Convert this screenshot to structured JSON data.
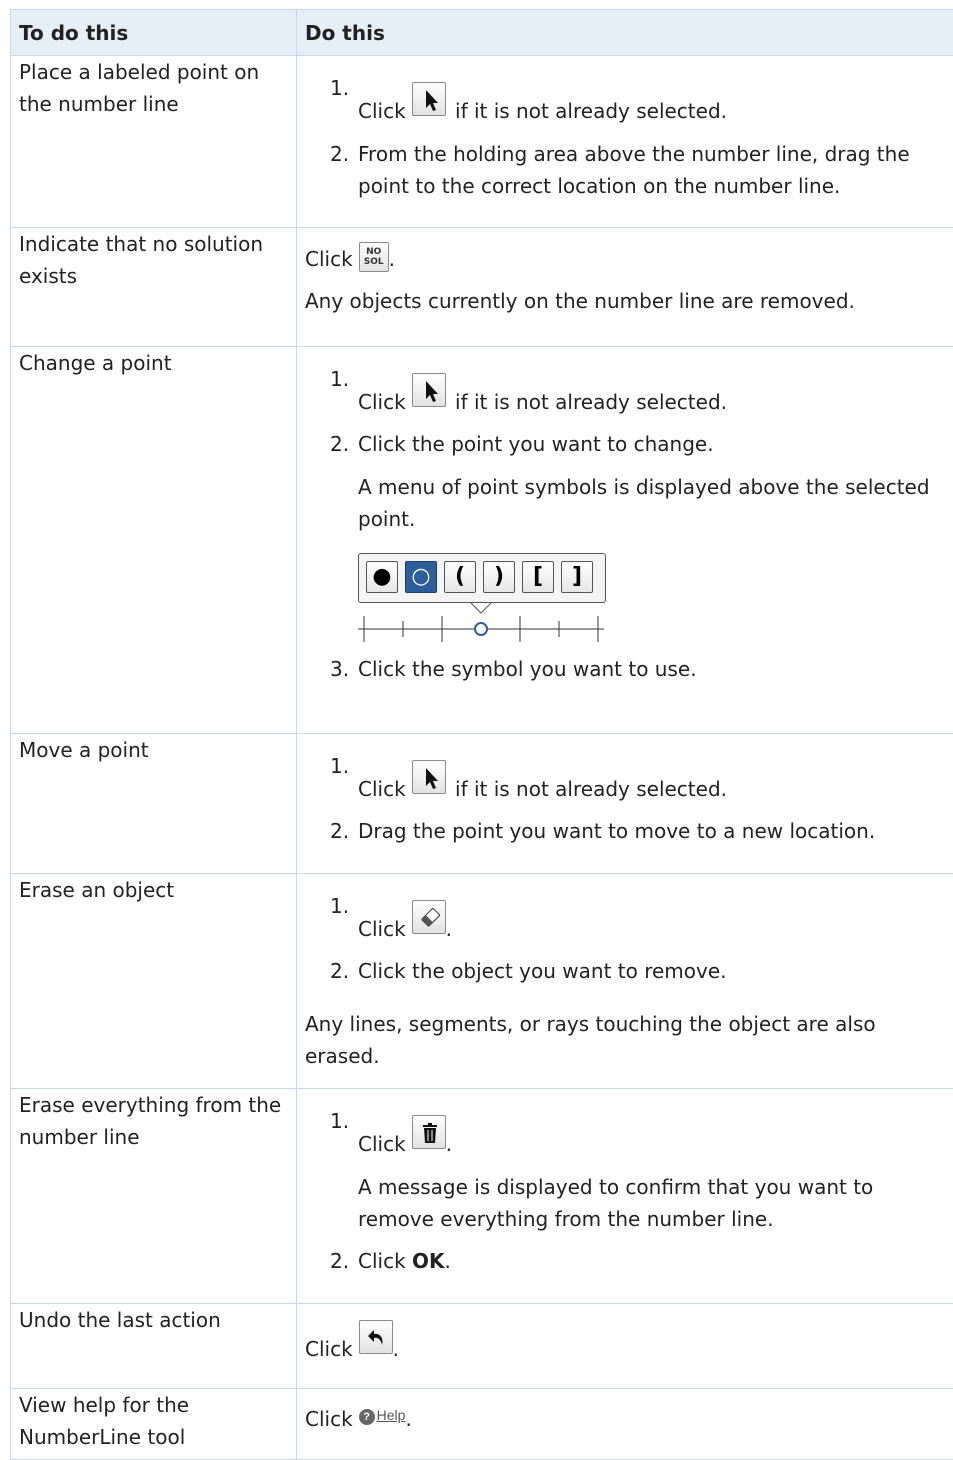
{
  "header": {
    "col1": "To do this",
    "col2": "Do this"
  },
  "rows": {
    "r0": {
      "task": "Place a labeled point on the number line",
      "s1_pre": "Click",
      "s1_post": " if it is not already selected.",
      "s2": "From the holding area above the number line, drag the point to the correct location on the number line."
    },
    "r1": {
      "task": "Indicate that no solution exists",
      "click": "Click",
      "period": ".",
      "nosol_top": "NO",
      "nosol_bottom": "SOL",
      "note": "Any objects currently on the number line are removed."
    },
    "r2": {
      "task": "Change a point",
      "s1_pre": "Click",
      "s1_post": " if it is not already selected.",
      "s2": "Click the point you want to change.",
      "s2_note": "A menu of point symbols is displayed above the selected point.",
      "symbols": [
        "●",
        "○",
        "(",
        ")",
        "[",
        "]"
      ],
      "s3": "Click the symbol you want to use."
    },
    "r3": {
      "task": "Move a point",
      "s1_pre": "Click",
      "s1_post": " if it is not already selected.",
      "s2": "Drag the point you want to move to a new location."
    },
    "r4": {
      "task": "Erase an object",
      "s1_pre": "Click",
      "period": ".",
      "s2": "Click the object you want to remove.",
      "note": "Any lines, segments, or rays touching the object are also erased."
    },
    "r5": {
      "task": "Erase everything from the number line",
      "s1_pre": "Click",
      "period": ".",
      "s1_note": "A message is displayed to confirm that you want to remove everything from the number line.",
      "s2_pre": "Click ",
      "s2_bold": "OK",
      "s2_post": "."
    },
    "r6": {
      "task": "Undo the last action",
      "click": "Click",
      "period": "."
    },
    "r7": {
      "task": "View help for the NumberLine tool",
      "click": "Click",
      "help_label": "Help",
      "period": "."
    }
  },
  "numbers": {
    "n1": "1.",
    "n2": "2.",
    "n3": "3."
  },
  "icons": {
    "select": "arrow-pointer-icon",
    "nosol": "no-solution-icon",
    "eraser": "eraser-icon",
    "trash": "trash-icon",
    "undo": "undo-icon",
    "help": "help-icon"
  },
  "colors": {
    "header_bg": "#e6eff8",
    "border": "#c9d9e8",
    "active_symbol": "#2e5d9a"
  }
}
